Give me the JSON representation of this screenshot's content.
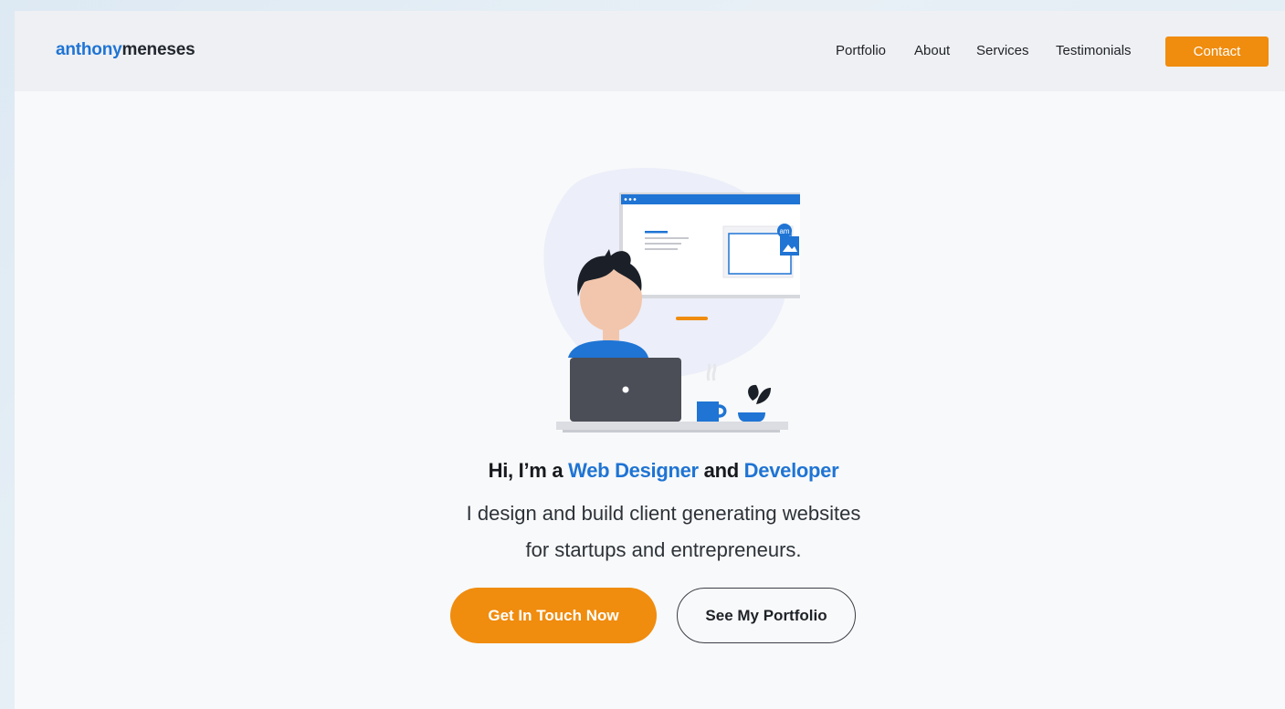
{
  "header": {
    "logo_first": "anthony",
    "logo_second": "meneses",
    "nav": {
      "portfolio": "Portfolio",
      "about": "About",
      "services": "Services",
      "testimonials": "Testimonials"
    },
    "contact_label": "Contact"
  },
  "hero": {
    "headline": {
      "part1": "Hi, I’m a ",
      "highlight1": "Web Designer",
      "part2": " and ",
      "highlight2": "Developer"
    },
    "subtitle_line1": "I design and build client generating websites",
    "subtitle_line2": "for startups and entrepreneurs.",
    "primary_cta": "Get In Touch Now",
    "secondary_cta": "See My Portfolio",
    "illustration_badge": "am"
  },
  "colors": {
    "accent_blue": "#1f74d4",
    "accent_orange": "#f08c0e",
    "text_dark": "#16191d"
  }
}
